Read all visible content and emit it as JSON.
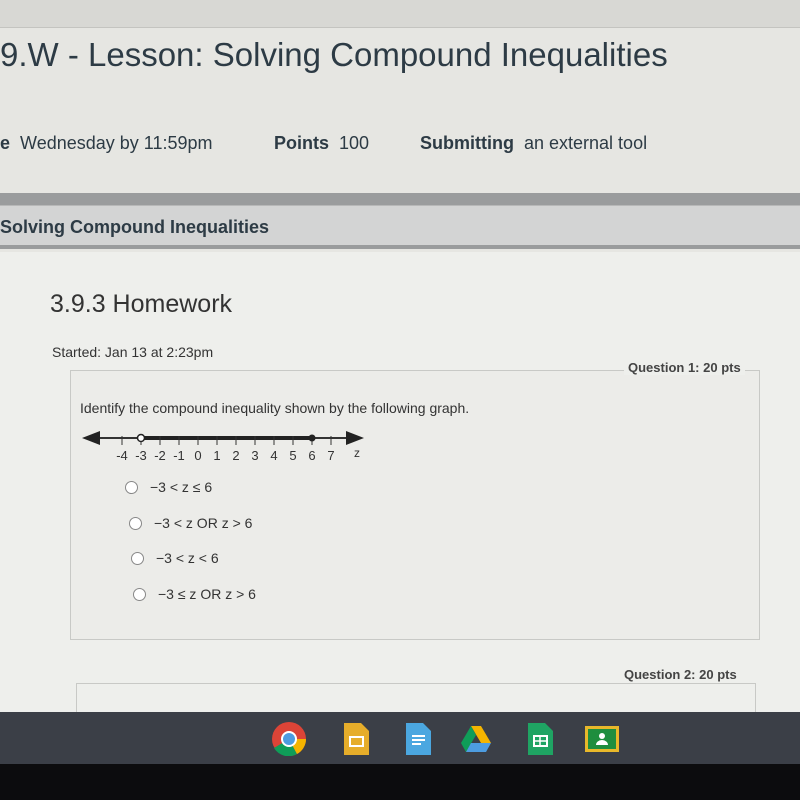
{
  "header": {
    "title": "9.W - Lesson: Solving Compound Inequalities"
  },
  "info": {
    "due_prefix": "e",
    "due": "Wednesday by 11:59pm",
    "points_label": "Points",
    "points": "100",
    "submitting_label": "Submitting",
    "submitting": "an external tool"
  },
  "module_title": "Solving Compound Inequalities",
  "assignment": {
    "title": "3.9.3 Homework",
    "started": "Started: Jan 13 at 2:23pm"
  },
  "question1": {
    "label": "Question 1: 20 pts",
    "prompt": "Identify the compound inequality shown by the following graph.",
    "number_line": {
      "ticks": [
        "-4",
        "-3",
        "-2",
        "-1",
        "0",
        "1",
        "2",
        "3",
        "4",
        "5",
        "6",
        "7"
      ],
      "variable": "z",
      "open_point": -3,
      "closed_point": 6,
      "shaded_from": -3,
      "shaded_to": 6
    },
    "options": [
      "−3 < z ≤ 6",
      "−3 < z OR z > 6",
      "−3 < z < 6",
      "−3 ≤ z OR z > 6"
    ]
  },
  "question2": {
    "label": "Question 2: 20 pts"
  },
  "taskbar": {
    "apps": [
      "chrome-icon",
      "slides-icon",
      "docs-icon",
      "drive-icon",
      "sheets-icon",
      "classroom-icon"
    ]
  }
}
